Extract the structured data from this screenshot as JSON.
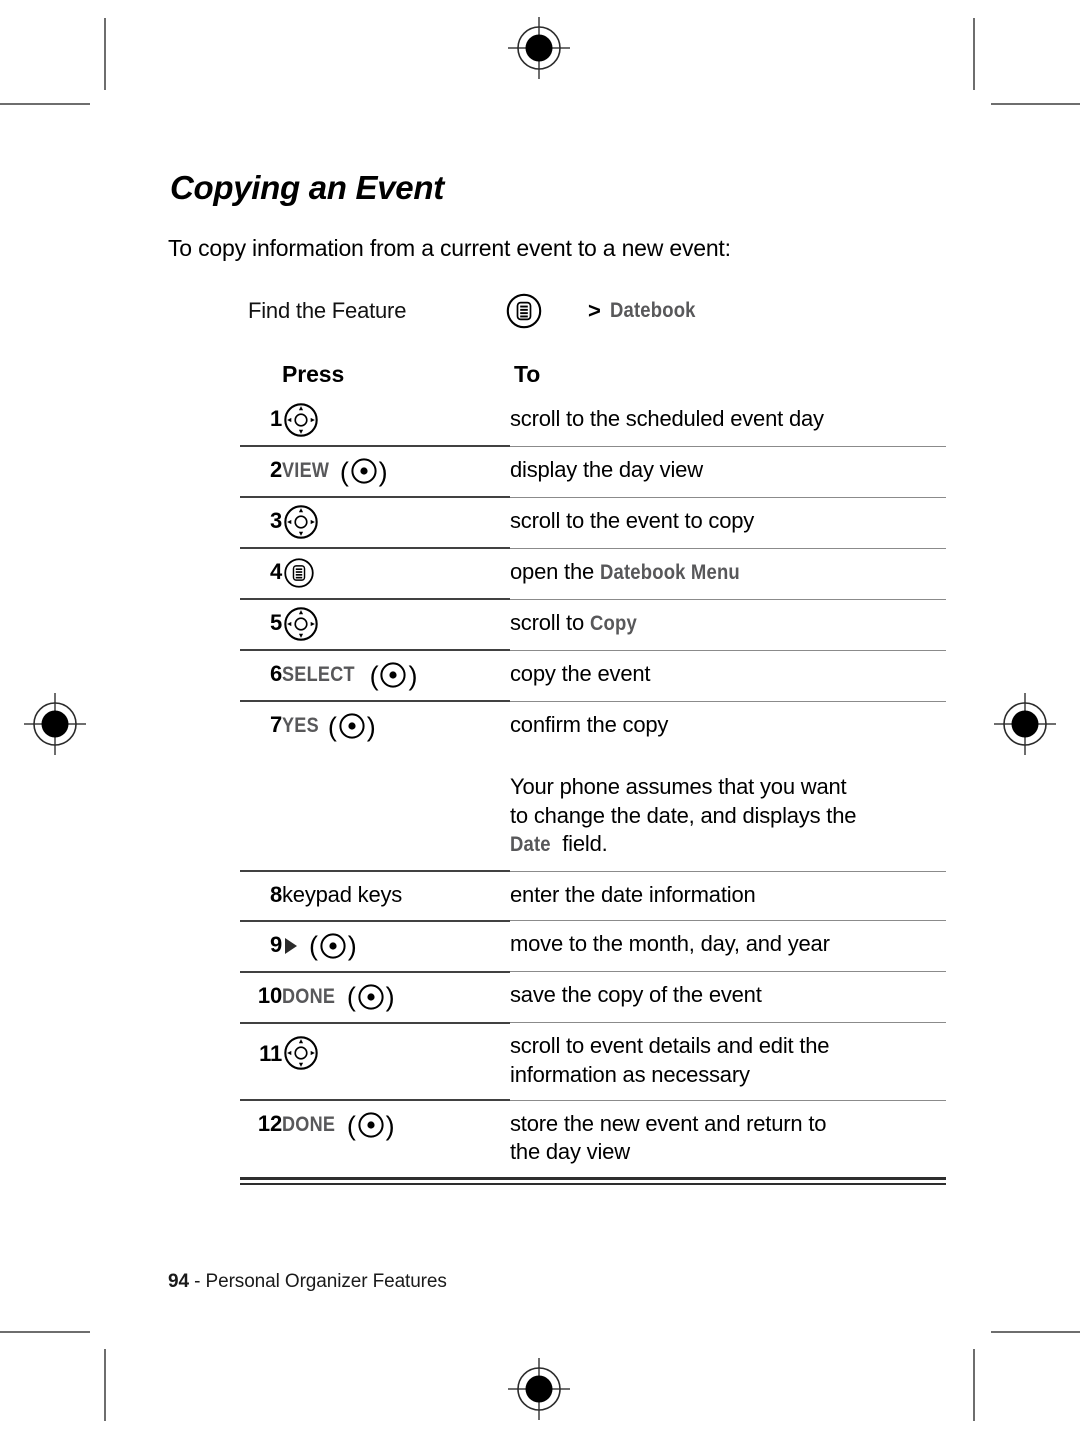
{
  "document": {
    "title": "Copying an Event",
    "intro": "To copy information from a current event to a new event:"
  },
  "find_the_feature": {
    "label": "Find the Feature",
    "menu_icon": "menu-key-icon",
    "separator": ">",
    "path": "Datebook"
  },
  "table": {
    "headers": {
      "num": "",
      "press": "Press",
      "to": "To"
    },
    "rows": [
      {
        "num": "1",
        "key_icon": "navigation-key-icon",
        "key_label": "",
        "desc": "scroll to the scheduled event day"
      },
      {
        "num": "2",
        "key_icon": "select-key-icon",
        "key_label": "VIEW",
        "desc": "display the day view"
      },
      {
        "num": "3",
        "key_icon": "navigation-key-icon",
        "key_label": "",
        "desc": "scroll to the event to copy"
      },
      {
        "num": "4",
        "key_icon": "menu-key-icon",
        "key_label": "",
        "desc": "open the ",
        "desc_screen": "Datebook Menu",
        "desc_tail": ""
      },
      {
        "num": "5",
        "key_icon": "navigation-key-icon",
        "key_label": "",
        "desc": "scroll to ",
        "desc_screen": "Copy",
        "desc_tail": ""
      },
      {
        "num": "6",
        "key_icon": "select-key-icon",
        "key_label": "SELECT",
        "desc": "copy the event"
      },
      {
        "num": "7",
        "key_icon": "select-key-icon",
        "key_label": "YES",
        "desc": "confirm the copy"
      },
      {
        "num": "",
        "key_icon": "",
        "key_label": "",
        "note_line1": "Your phone assumes that you want",
        "note_line2": "to change the date, and displays the",
        "note_screen": "Date",
        "note_tail": " field."
      },
      {
        "num": "8",
        "key_icon": "",
        "key_label": "",
        "key_text": "keypad keys",
        "desc": "enter the date information"
      },
      {
        "num": "9",
        "key_icon": "select-key-icon",
        "key_prefix_icon": "right-arrow-icon",
        "key_label": "",
        "desc": "move to the month, day, and year"
      },
      {
        "num": "10",
        "key_icon": "select-key-icon",
        "key_label": "DONE",
        "desc": "save the copy of the event"
      },
      {
        "num": "11",
        "key_icon": "navigation-key-icon",
        "key_label": "",
        "desc_line1": "scroll to event details and edit the",
        "desc_line2": "information as necessary"
      },
      {
        "num": "12",
        "key_icon": "select-key-icon",
        "key_label": "DONE",
        "desc_line1": "store the new event and return to",
        "desc_line2": "the day view"
      }
    ]
  },
  "footer": {
    "page_number": "94",
    "dash": " - ",
    "section": "Personal Organizer Features"
  },
  "print_marks": {
    "registration_mark": "registration-target-mark",
    "colors": {
      "mark_gray": "#6e6e6e",
      "screen_text_gray": "#58585a",
      "rule_dark": "#414141",
      "rule_light": "#8b8b8b"
    }
  }
}
